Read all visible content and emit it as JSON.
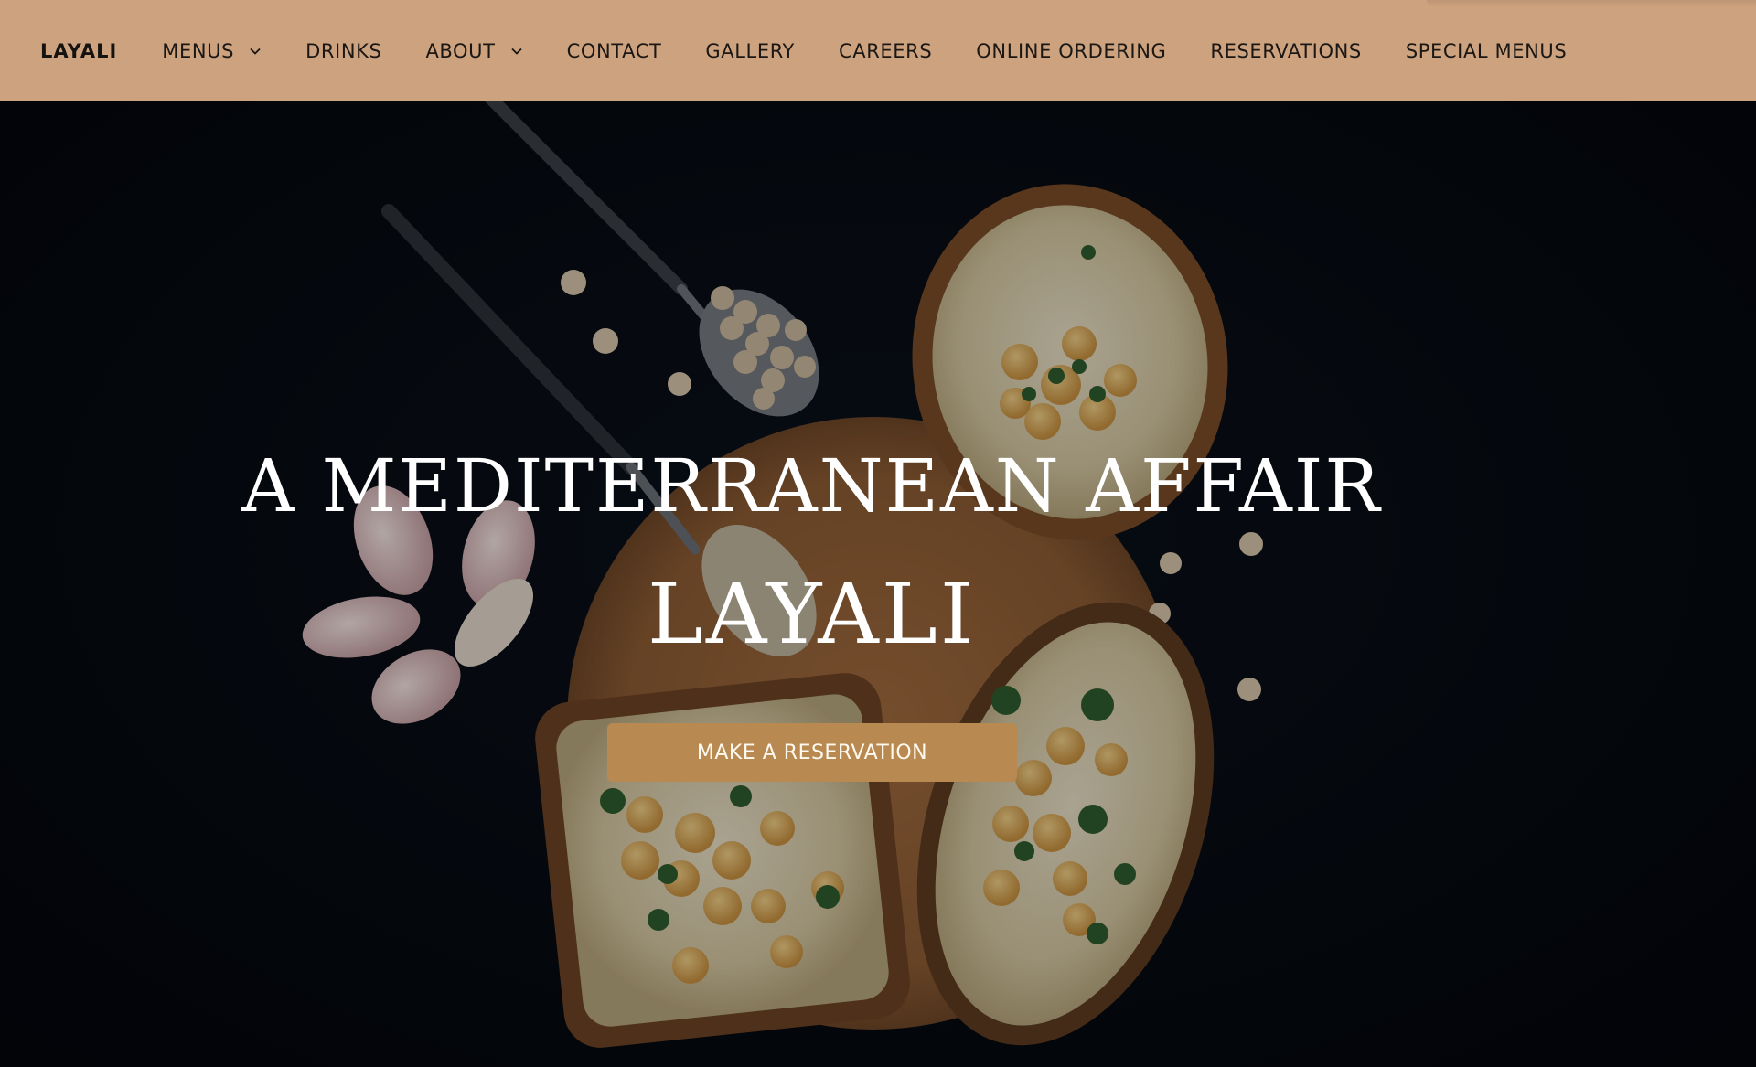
{
  "nav": {
    "brand": "LAYALI",
    "items": [
      {
        "label": "MENUS",
        "dropdown": true
      },
      {
        "label": "DRINKS",
        "dropdown": false
      },
      {
        "label": "ABOUT",
        "dropdown": true
      },
      {
        "label": "CONTACT",
        "dropdown": false
      },
      {
        "label": "GALLERY",
        "dropdown": false
      },
      {
        "label": "CAREERS",
        "dropdown": false
      },
      {
        "label": "ONLINE ORDERING",
        "dropdown": false
      },
      {
        "label": "RESERVATIONS",
        "dropdown": false
      },
      {
        "label": "SPECIAL MENUS",
        "dropdown": false
      }
    ]
  },
  "hero": {
    "headline": "A MEDITERRANEAN AFFAIR",
    "title": "LAYALI",
    "cta_label": "MAKE A RESERVATION",
    "image": "hummus-bowls-chickpeas-garlic-on-dark-background"
  },
  "colors": {
    "nav_background": "#cda27e",
    "cta_background": "#b88a52",
    "hero_background": "#05070d",
    "text_light": "#ffffff"
  }
}
